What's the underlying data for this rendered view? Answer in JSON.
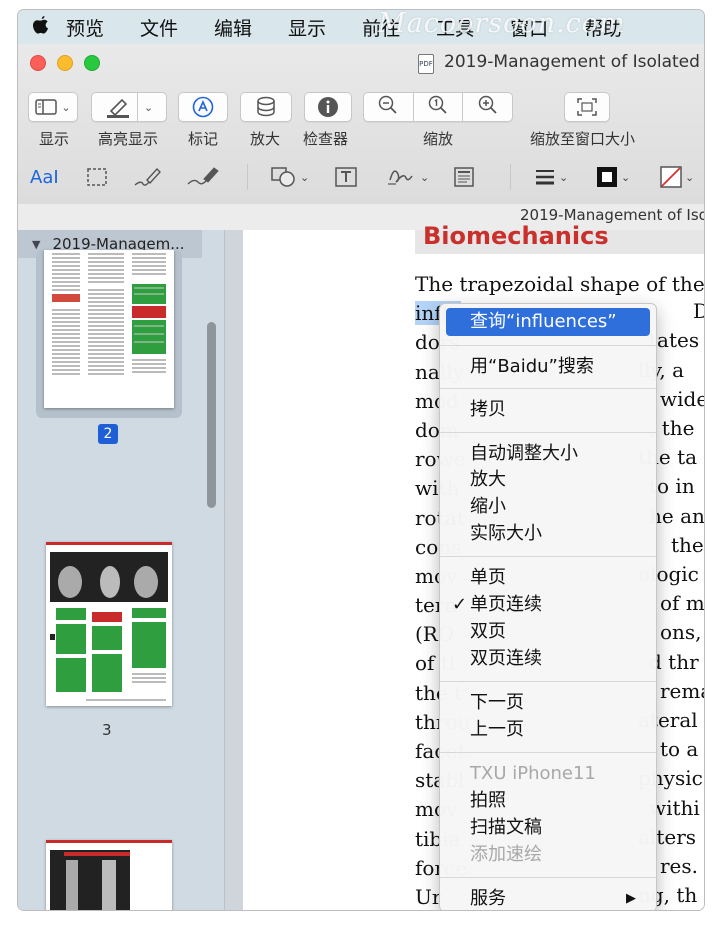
{
  "menubar": {
    "items": [
      "预览",
      "文件",
      "编辑",
      "显示",
      "前往",
      "工具",
      "窗口",
      "帮助"
    ],
    "watermark": "Macoorsoon.com"
  },
  "window": {
    "title": "2019-Management of Isolated",
    "doc_icon_text": "PDF"
  },
  "toolbar": {
    "view_label": "显示",
    "highlight_label": "高亮显示",
    "markup_label": "标记",
    "zoom_tool_label": "放大",
    "inspector_label": "检查器",
    "zoom_label": "缩放",
    "fit_window_label": "缩放至窗口大小",
    "text_tool_glyph": "AaI"
  },
  "strip": {
    "title": "2019-Management of Iso"
  },
  "sidebar": {
    "header": "2019-Managem...",
    "pages": [
      {
        "number": "2",
        "selected": true
      },
      {
        "number": "3",
        "selected": false
      }
    ]
  },
  "document": {
    "heading": "Biomechanics",
    "lines": [
      {
        "pre": "The trapezoidal shape of the",
        "hl": "",
        "post": ""
      },
      {
        "pre": "",
        "hl": "influ",
        "post": ""
      },
      {
        "pre": "dors",
        "hl": "",
        "post": ""
      },
      {
        "pre": "nally",
        "hl": "",
        "post": ""
      },
      {
        "pre": "mod",
        "hl": "",
        "post": ""
      },
      {
        "pre": "dom",
        "hl": "",
        "post": ""
      },
      {
        "pre": "rowe",
        "hl": "",
        "post": ""
      },
      {
        "pre": "with",
        "hl": "",
        "post": ""
      },
      {
        "pre": "rotat",
        "hl": "",
        "post": ""
      },
      {
        "pre": "cons",
        "hl": "",
        "post": ""
      },
      {
        "pre": "mov",
        "hl": "",
        "post": ""
      },
      {
        "pre": "tern",
        "hl": "",
        "post": ""
      },
      {
        "pre": "(RO",
        "hl": "",
        "post": ""
      },
      {
        "pre": "of tl",
        "hl": "",
        "post": ""
      },
      {
        "pre": "the t",
        "hl": "",
        "post": ""
      },
      {
        "pre": "throu",
        "hl": "",
        "post": ""
      },
      {
        "pre": "facet",
        "hl": "",
        "post": ""
      },
      {
        "pre": "stabl",
        "hl": "",
        "post": ""
      },
      {
        "pre": "mov",
        "hl": "",
        "post": ""
      },
      {
        "pre": "tibia",
        "hl": "",
        "post": ""
      },
      {
        "pre": "force",
        "hl": "",
        "post": ""
      },
      {
        "pre": "  Ur",
        "hl": "",
        "post": ""
      }
    ],
    "right_fragments": [
      "D",
      "tates",
      "lly, a",
      "wide",
      ", the",
      "the ta",
      "to in",
      "he an",
      "the",
      "ologic",
      "of m",
      "ons,",
      "d thr",
      "rema",
      "ateral",
      "to a",
      "physic",
      "withi",
      "alters",
      "res.",
      "ng, th"
    ]
  },
  "context_menu": {
    "items": [
      {
        "label": "查询“influences”",
        "state": "active"
      },
      {
        "label": "用“Baidu”搜索",
        "state": "normal"
      },
      {
        "label": "拷贝",
        "state": "normal"
      },
      {
        "label": "自动调整大小",
        "state": "normal"
      },
      {
        "label": "放大",
        "state": "normal"
      },
      {
        "label": "缩小",
        "state": "normal"
      },
      {
        "label": "实际大小",
        "state": "normal"
      },
      {
        "label": "单页",
        "state": "normal"
      },
      {
        "label": "单页连续",
        "state": "checked"
      },
      {
        "label": "双页",
        "state": "normal"
      },
      {
        "label": "双页连续",
        "state": "normal"
      },
      {
        "label": "下一页",
        "state": "normal"
      },
      {
        "label": "上一页",
        "state": "normal"
      },
      {
        "label": "TXU iPhone11",
        "state": "disabled"
      },
      {
        "label": "拍照",
        "state": "normal"
      },
      {
        "label": "扫描文稿",
        "state": "normal"
      },
      {
        "label": "添加速绘",
        "state": "disabled"
      },
      {
        "label": "服务",
        "state": "submenu"
      }
    ],
    "check_glyph": "✓",
    "submenu_glyph": "▶"
  },
  "colors": {
    "menubar_bg": "#d9e7ec",
    "heading_red": "#c9302c",
    "selection_blue": "#2e6fdb",
    "text_highlight": "#b3d3f7",
    "page_badge": "#1f5fd6"
  }
}
